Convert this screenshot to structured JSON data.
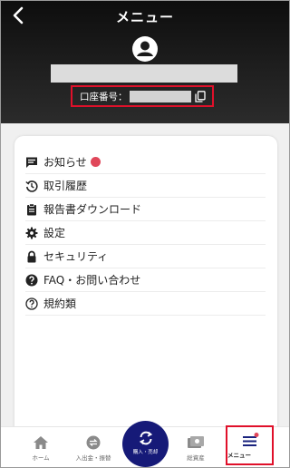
{
  "header": {
    "title": "メニュー",
    "account_label": "口座番号："
  },
  "menu": {
    "items": [
      {
        "label": "お知らせ",
        "icon": "message-icon"
      },
      {
        "label": "取引履歴",
        "icon": "history-icon"
      },
      {
        "label": "報告書ダウンロード",
        "icon": "clipboard-icon"
      },
      {
        "label": "設定",
        "icon": "gear-icon"
      },
      {
        "label": "セキュリティ",
        "icon": "lock-icon"
      },
      {
        "label": "FAQ・お問い合わせ",
        "icon": "help-icon"
      },
      {
        "label": "規約類",
        "icon": "question-outline-icon"
      }
    ]
  },
  "bottom_nav": {
    "home": "ホーム",
    "transfer": "入出金・振替",
    "trade": "購入・売却",
    "assets": "総資産",
    "menu": "メニュー"
  },
  "colors": {
    "header_bg": "#1a1a1a",
    "highlight_red": "#e0102a",
    "badge_red": "#e0475a",
    "center_button": "#161a78"
  }
}
